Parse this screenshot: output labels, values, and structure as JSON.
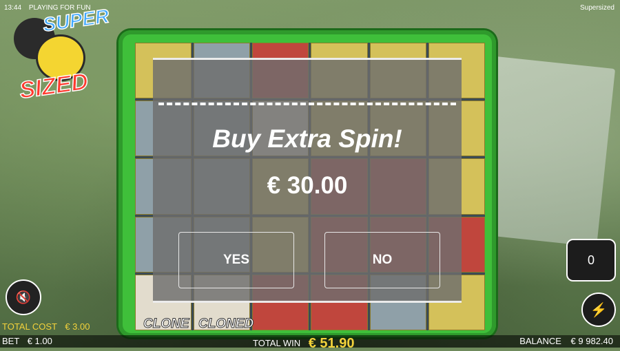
{
  "status": {
    "time": "13:44",
    "mode": "PLAYING FOR FUN",
    "game": "Supersized"
  },
  "logo": {
    "line1": "SUPER",
    "line2": "SIZED"
  },
  "popup": {
    "title": "Buy Extra Spin!",
    "price": "€ 30.00",
    "yes_label": "YES",
    "no_label": "NO"
  },
  "reels": {
    "clone_label": "CLONE",
    "cloned_label": "CLONED"
  },
  "controls": {
    "counter_value": "0",
    "mute_icon": "speaker-mute-icon",
    "bolt_icon": "lightning-icon"
  },
  "footer": {
    "total_cost_label": "TOTAL COST",
    "total_cost_value": "€ 3.00",
    "bet_label": "BET",
    "bet_value": "€ 1.00",
    "total_win_label": "TOTAL WIN",
    "total_win_value": "€ 51.90",
    "balance_label": "BALANCE",
    "balance_value": "€ 9 982.40"
  },
  "colors": {
    "board_green": "#3fbf3a",
    "win_gold": "#f3d23b"
  }
}
